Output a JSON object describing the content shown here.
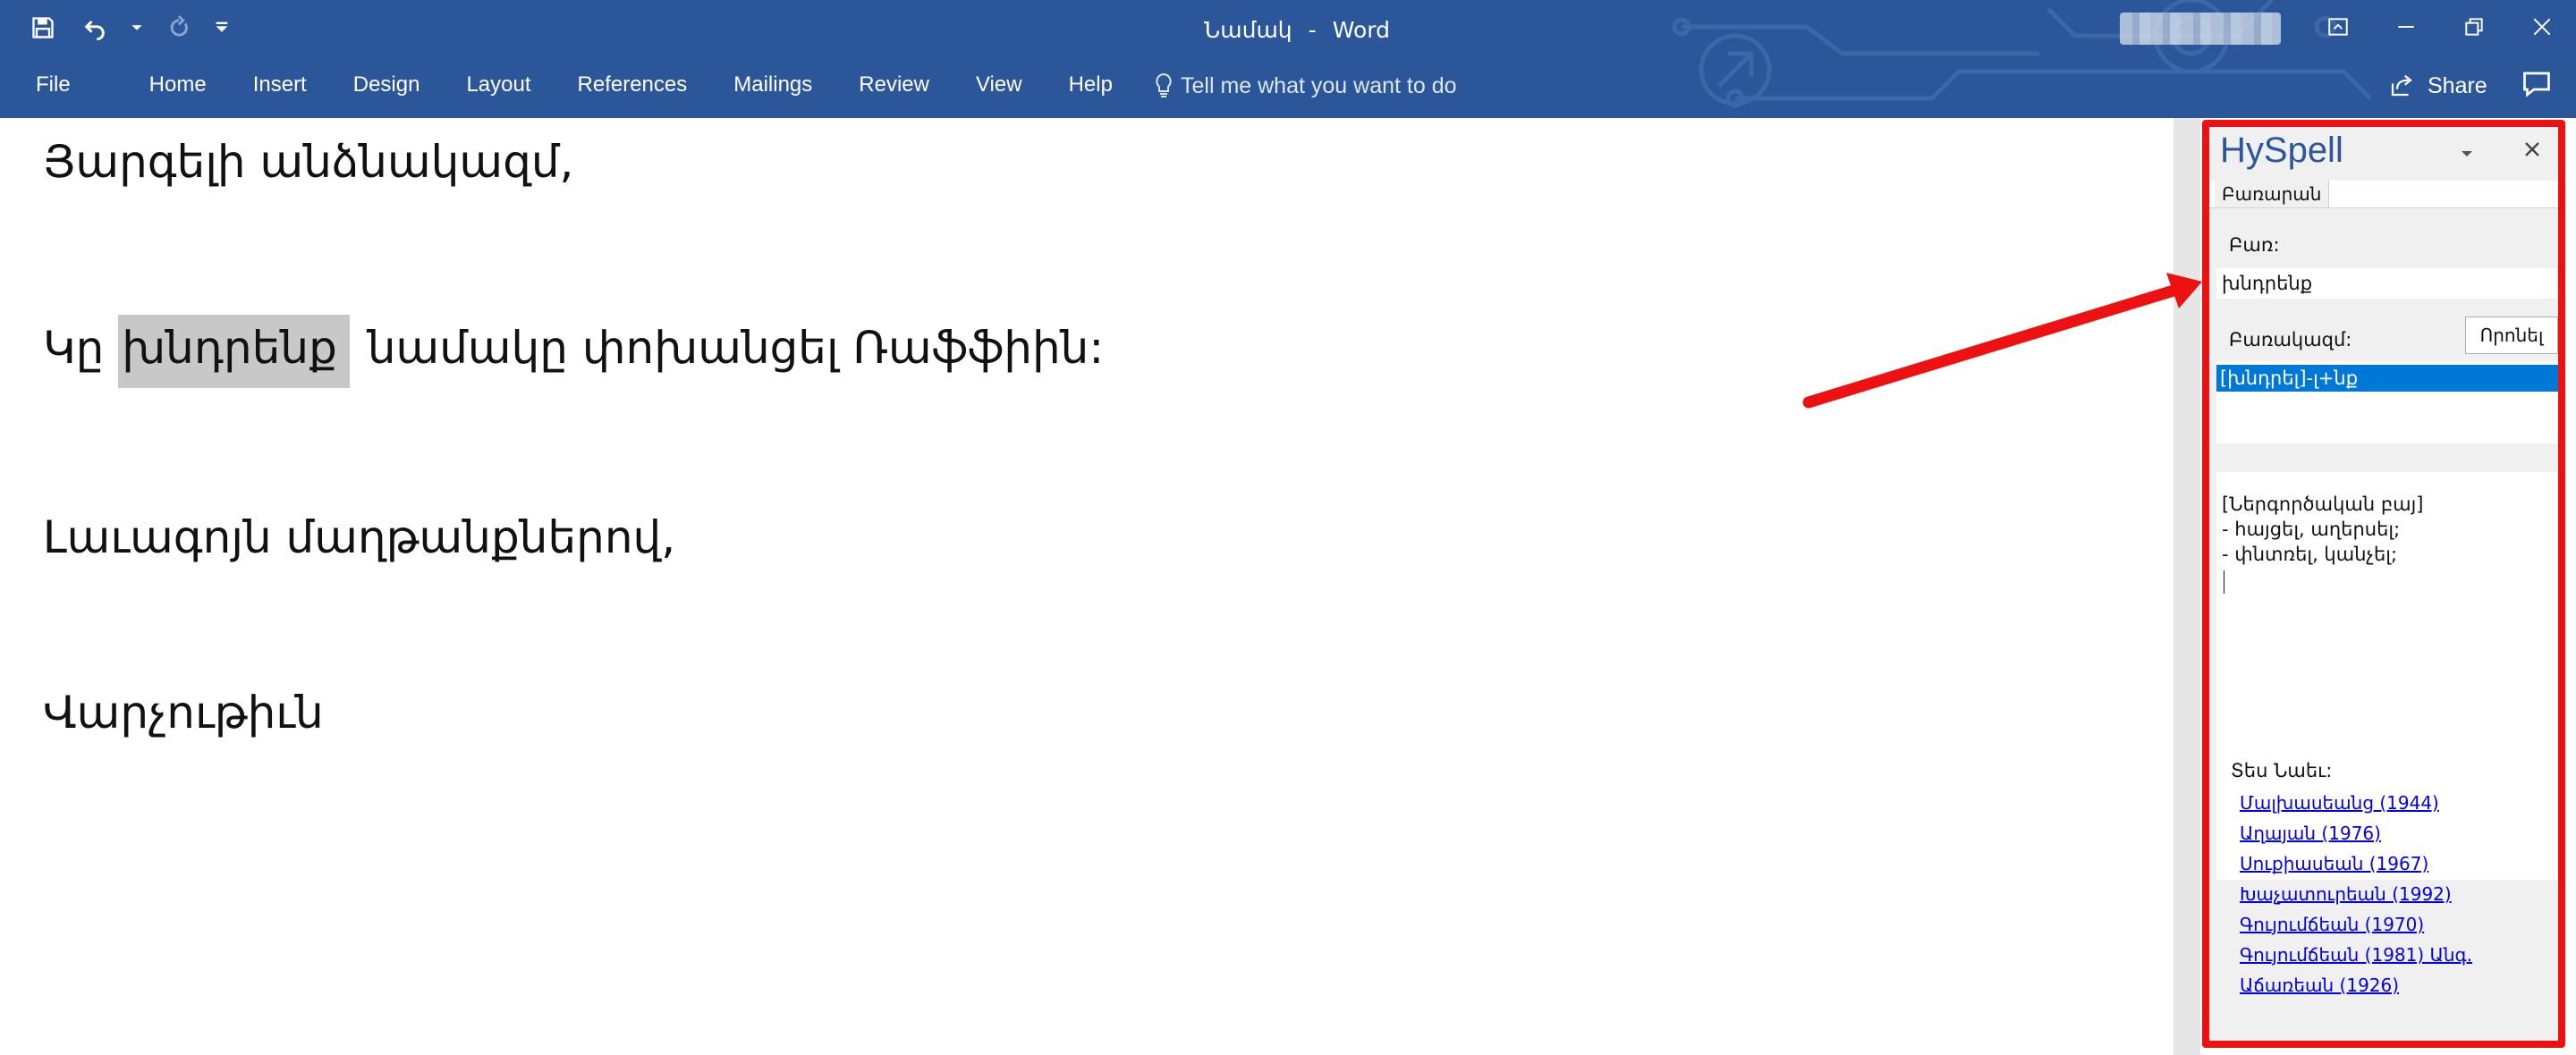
{
  "window": {
    "document_name": "Նամակ",
    "separator": "-",
    "app_name": "Word"
  },
  "ribbon": {
    "tabs": [
      "File",
      "Home",
      "Insert",
      "Design",
      "Layout",
      "References",
      "Mailings",
      "Review",
      "View",
      "Help"
    ],
    "tell_me": "Tell me what you want to do",
    "share": "Share"
  },
  "document": {
    "line1": "Յարգելի անձնակազմ,",
    "line2_before": "Կը ",
    "line2_selected": "խնդրենք",
    "line2_after": " նամակը փոխանցել Ռաֆֆիին:",
    "line3": "Լաւագոյն մաղթանքներով,",
    "line4": "Վարչութիւն"
  },
  "hyspell": {
    "title": "HySpell",
    "tab": "Բառարան",
    "word_label": "Բառ:",
    "word_value": "խնդրենք",
    "lexeme_label": "Բառակազմ:",
    "search_button": "Որոնել",
    "lexeme_item": "[խնդրել]-լ+նք",
    "definition": [
      "[Ներգործական բայ]",
      "- հայցել, աղերսել;",
      "- փնտռել, կանչել;"
    ],
    "see_also_label": "Տես Նաեւ:",
    "references": [
      "Մալխասեանց (1944)",
      "Աղայան (1976)",
      "Սուքիասեան (1967)",
      "Խաչատուրեան (1992)",
      "Գույումճեան (1970)",
      "Գույումճեան (1981) Անգ.",
      "Աճառեան (1926)"
    ]
  },
  "annotation": {
    "color": "#ee1111"
  },
  "colors": {
    "ribbon": "#2b579a",
    "selection": "#0078d7",
    "highlight": "#c8c8c8"
  }
}
